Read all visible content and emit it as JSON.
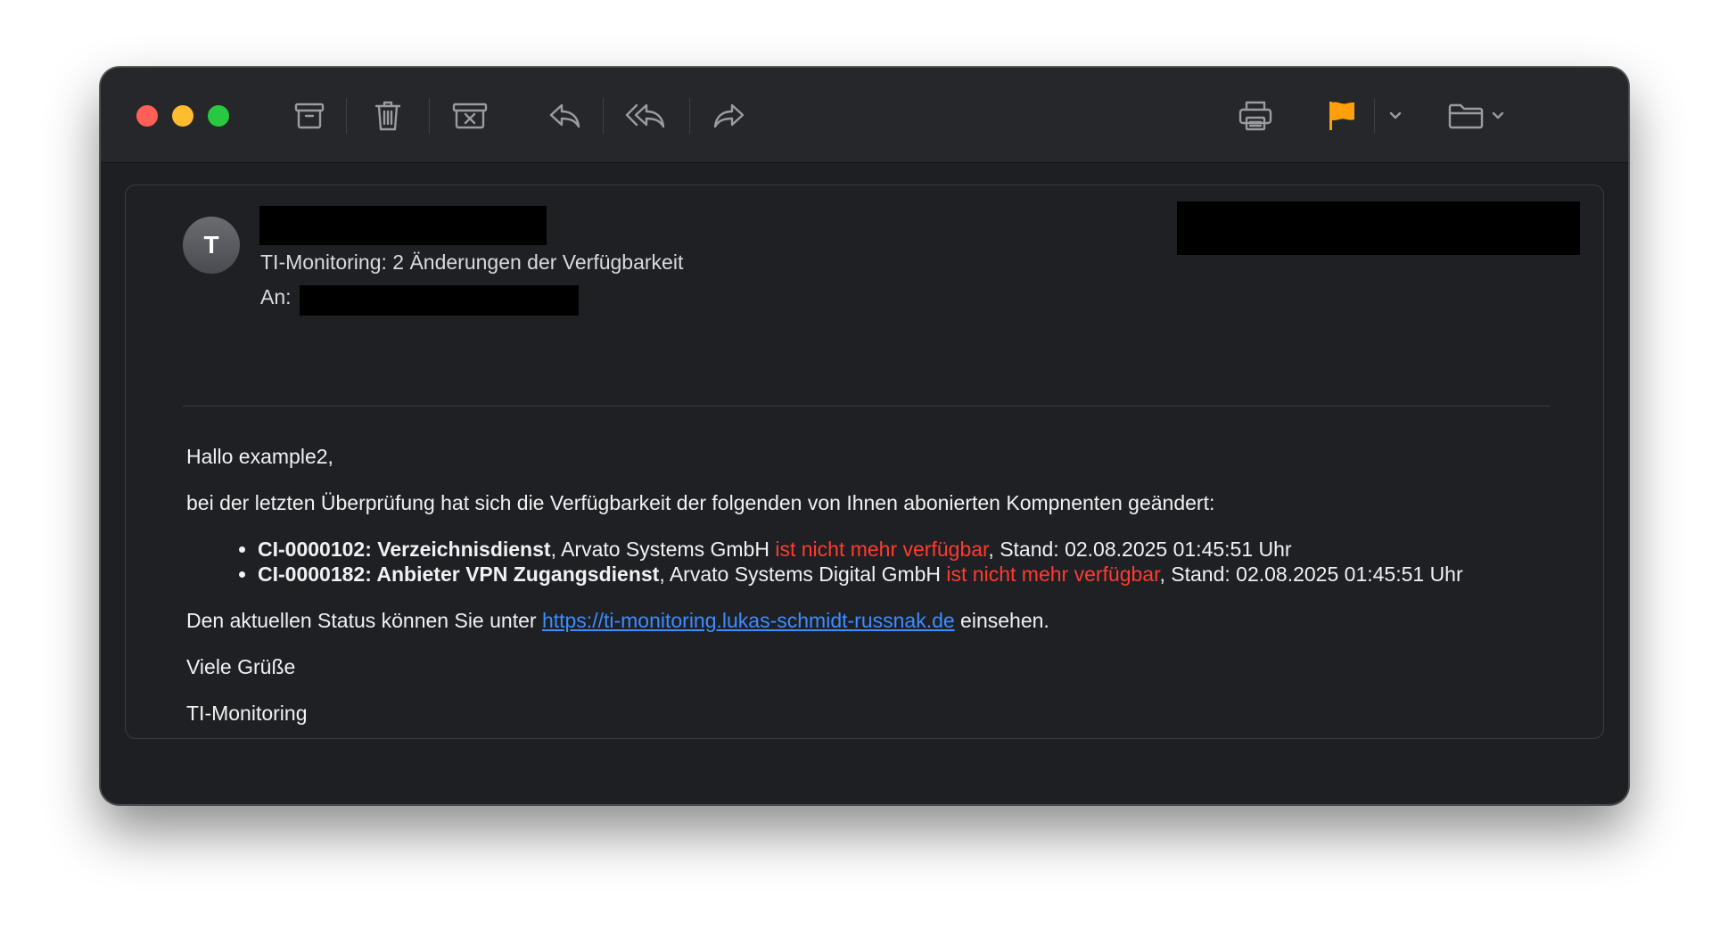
{
  "toolbar": {
    "icons": [
      "archive-icon",
      "trash-icon",
      "junk-icon",
      "reply-icon",
      "reply-all-icon",
      "forward-icon",
      "print-icon",
      "flag-icon",
      "chevron-down-icon",
      "folder-icon"
    ],
    "flag_color": "#ff9f0a"
  },
  "message": {
    "avatar_initial": "T",
    "subject": "TI-Monitoring: 2 Änderungen der Verfügbarkeit",
    "to_label": "An:"
  },
  "body": {
    "greeting": "Hallo example2,",
    "intro": "bei der letzten Überprüfung hat sich die Verfügbarkeit der folgenden von Ihnen abonierten Kompnenten geändert:",
    "items": [
      {
        "component": "CI-0000102: Verzeichnisdienst",
        "provider": ", Arvato Systems GmbH ",
        "status": "ist nicht mehr verfügbar",
        "stand": ", Stand: 02.08.2025 01:45:51 Uhr"
      },
      {
        "component": "CI-0000182: Anbieter VPN Zugangsdienst",
        "provider": ", Arvato Systems Digital GmbH ",
        "status": "ist nicht mehr verfügbar",
        "stand": ", Stand: 02.08.2025 01:45:51 Uhr"
      }
    ],
    "status_prefix": "Den aktuellen Status können Sie unter ",
    "status_link": "https://ti-monitoring.lukas-schmidt-russnak.de",
    "status_suffix": " einsehen.",
    "closing": "Viele Grüße",
    "signature": "TI-Monitoring"
  },
  "colors": {
    "status_unavailable": "#ff3b30",
    "link": "#3d8dff"
  }
}
